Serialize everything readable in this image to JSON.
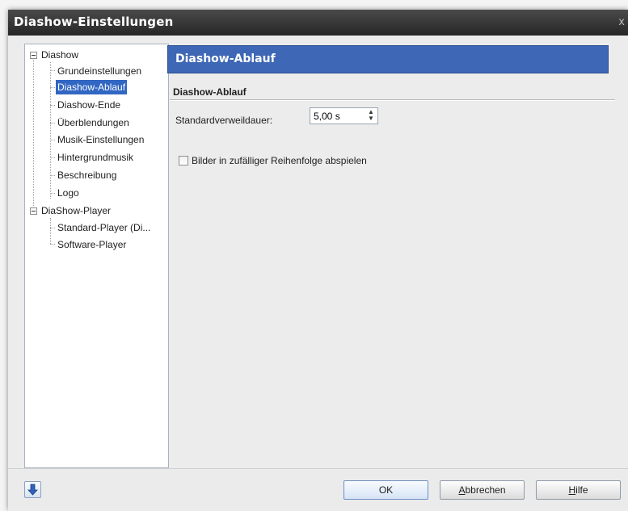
{
  "window": {
    "title": "Diashow-Einstellungen",
    "close_glyph": "x"
  },
  "tree": {
    "groups": [
      {
        "label": "Diashow",
        "expanded": true,
        "children": [
          "Grundeinstellungen",
          "Diashow-Ablauf",
          "Diashow-Ende",
          "Überblendungen",
          "Musik-Einstellungen",
          "Hintergrundmusik",
          "Beschreibung",
          "Logo"
        ]
      },
      {
        "label": "DiaShow-Player",
        "expanded": true,
        "children": [
          "Standard-Player (Di...",
          "Software-Player"
        ]
      }
    ],
    "selected": "Diashow-Ablauf"
  },
  "panel": {
    "header": "Diashow-Ablauf",
    "section_title": "Diashow-Ablauf",
    "duration_label": "Standardverweildauer:",
    "duration_value": "5,00 s",
    "random_order_label": "Bilder in zufälliger Reihenfolge abspielen",
    "random_order_checked": false
  },
  "footer": {
    "icon": "down-arrow-icon",
    "ok_label": "OK",
    "cancel_label": "Abbrechen",
    "help_label": "Hilfe"
  },
  "colors": {
    "accent": "#3e67b6",
    "selection": "#3166c3",
    "titlebar": "#2f2f2f"
  }
}
